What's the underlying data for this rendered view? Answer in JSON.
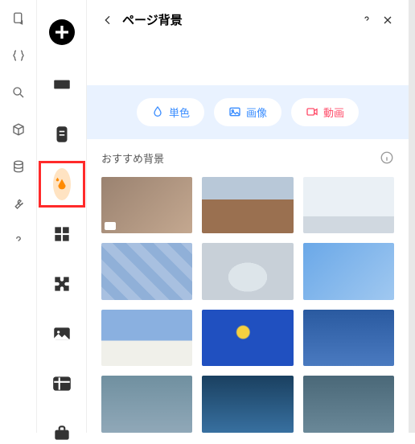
{
  "rail": [
    {
      "name": "file-icon"
    },
    {
      "name": "braces-icon"
    },
    {
      "name": "search-icon"
    },
    {
      "name": "cube-icon"
    },
    {
      "name": "database-icon"
    },
    {
      "name": "wrench-icon"
    },
    {
      "name": "help-icon"
    }
  ],
  "tools": [
    {
      "name": "add-circle-icon"
    },
    {
      "name": "section-icon"
    },
    {
      "name": "page-icon"
    },
    {
      "name": "theme-icon"
    },
    {
      "name": "apps-grid-icon"
    },
    {
      "name": "puzzle-icon"
    },
    {
      "name": "image-icon"
    },
    {
      "name": "table-icon"
    },
    {
      "name": "briefcase-icon"
    }
  ],
  "panel": {
    "title": "ページ背景",
    "tabs": [
      {
        "label": "単色",
        "icon": "drop-icon"
      },
      {
        "label": "画像",
        "icon": "picture-icon"
      },
      {
        "label": "動画",
        "icon": "video-icon"
      }
    ],
    "section_title": "おすすめ背景",
    "thumbs": [
      {
        "name": "bg-shadow-leaves",
        "video": true
      },
      {
        "name": "bg-mountain-cabin"
      },
      {
        "name": "bg-dancer-white"
      },
      {
        "name": "bg-baseballs-blue"
      },
      {
        "name": "bg-sculpture-gray"
      },
      {
        "name": "bg-glass-building"
      },
      {
        "name": "bg-santorini"
      },
      {
        "name": "bg-lemon-blue"
      },
      {
        "name": "bg-tennis-player"
      },
      {
        "name": "bg-clouds-1"
      },
      {
        "name": "bg-ocean-dark"
      },
      {
        "name": "bg-clouds-2"
      }
    ]
  }
}
